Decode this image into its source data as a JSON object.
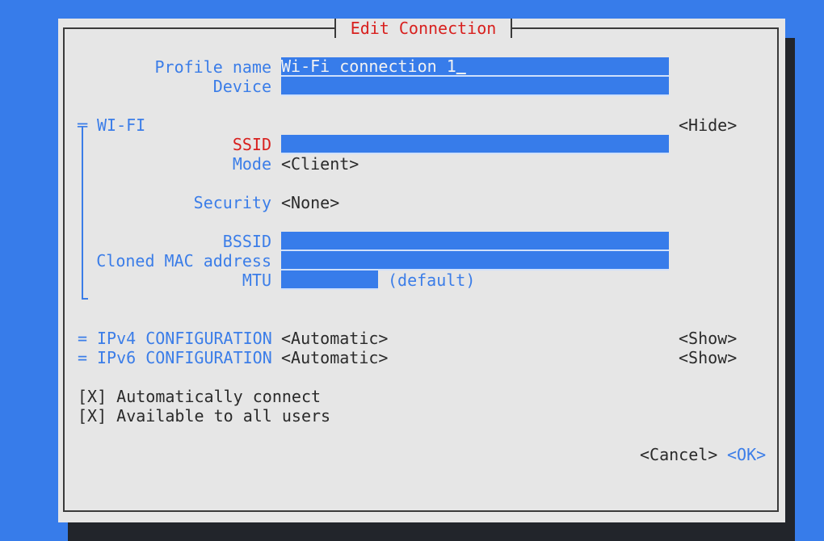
{
  "dialog": {
    "title": "Edit Connection"
  },
  "fields": {
    "profile_name": {
      "label": "Profile name",
      "value": "Wi-Fi connection 1"
    },
    "device": {
      "label": "Device",
      "value": ""
    }
  },
  "wifi": {
    "header": "WI-FI",
    "toggle": "<Hide>",
    "ssid": {
      "label": "SSID",
      "value": ""
    },
    "mode": {
      "label": "Mode",
      "value": "<Client>"
    },
    "security": {
      "label": "Security",
      "value": "<None>"
    },
    "bssid": {
      "label": "BSSID",
      "value": ""
    },
    "cloned_mac": {
      "label": "Cloned MAC address",
      "value": ""
    },
    "mtu": {
      "label": "MTU",
      "value": "",
      "hint": "(default)"
    }
  },
  "ipv4": {
    "marker": "=",
    "label": "IPv4 CONFIGURATION",
    "value": "<Automatic>",
    "toggle": "<Show>"
  },
  "ipv6": {
    "marker": "=",
    "label": "IPv6 CONFIGURATION",
    "value": "<Automatic>",
    "toggle": "<Show>"
  },
  "checkboxes": [
    {
      "mark": "[X]",
      "label": "Automatically connect",
      "checked": true
    },
    {
      "mark": "[X]",
      "label": "Available to all users",
      "checked": true
    }
  ],
  "buttons": {
    "cancel": "<Cancel>",
    "ok": "<OK>"
  },
  "colors": {
    "background": "#377cea",
    "dialog": "#e6e6e6",
    "label": "#3b7de8",
    "required": "#d8201e",
    "text": "#2a2a2a"
  }
}
